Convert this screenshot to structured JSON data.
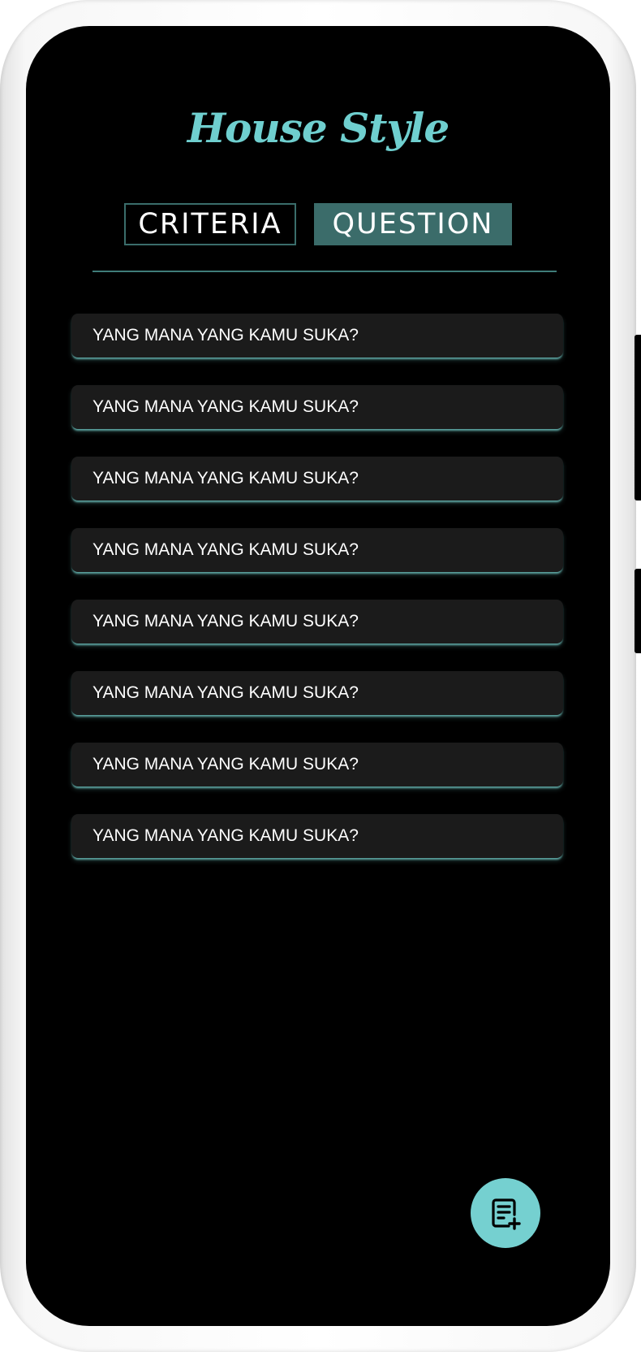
{
  "app": {
    "title": "House Style"
  },
  "tabs": [
    {
      "label": "CRITERIA",
      "active": false
    },
    {
      "label": "QUESTION",
      "active": true
    }
  ],
  "questions": [
    {
      "label": "YANG MANA YANG KAMU SUKA?"
    },
    {
      "label": "YANG MANA YANG KAMU SUKA?"
    },
    {
      "label": "YANG MANA YANG KAMU SUKA?"
    },
    {
      "label": "YANG MANA YANG KAMU SUKA?"
    },
    {
      "label": "YANG MANA YANG KAMU SUKA?"
    },
    {
      "label": "YANG MANA YANG KAMU SUKA?"
    },
    {
      "label": "YANG MANA YANG KAMU SUKA?"
    },
    {
      "label": "YANG MANA YANG KAMU SUKA?"
    }
  ],
  "fab": {
    "icon": "note-add-icon"
  },
  "colors": {
    "accent": "#75d0d0",
    "tab_active_bg": "#3b6c6a",
    "background": "#000000",
    "card_bg": "#1b1b1b"
  }
}
